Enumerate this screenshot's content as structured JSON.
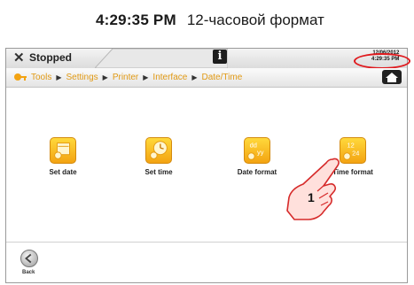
{
  "caption": {
    "time": "4:29:35 PM",
    "format": "12-часовой формат"
  },
  "status": {
    "text": "Stopped",
    "date": "12/06/2012",
    "clock": "4:29:35 PM"
  },
  "breadcrumb": [
    "Tools",
    "Settings",
    "Printer",
    "Interface",
    "Date/Time"
  ],
  "items": [
    {
      "label": "Set date",
      "icon": "calendar-icon"
    },
    {
      "label": "Set time",
      "icon": "clock-icon"
    },
    {
      "label": "Date format",
      "icon": "dd-yy-icon",
      "glyph_top": "dd",
      "glyph_bottom": "yy"
    },
    {
      "label": "Time format",
      "icon": "12-24-icon",
      "glyph_top": "12",
      "glyph_bottom": "24"
    }
  ],
  "footer": {
    "back_label": "Back"
  },
  "annotation": {
    "step": "1"
  },
  "colors": {
    "accent": "#f3a312",
    "highlight": "#e0191d"
  }
}
